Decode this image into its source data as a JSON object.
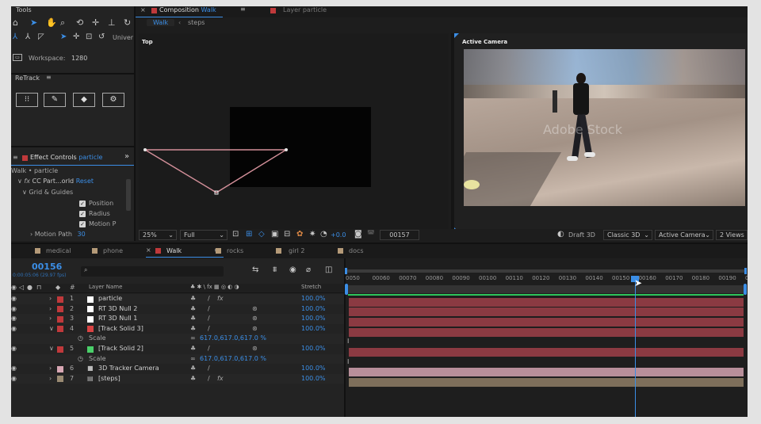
{
  "tools_panel": {
    "title": "Tools",
    "universal_label": "Univer",
    "workspace_label": "Workspace:",
    "workspace_value": "1280"
  },
  "retrack": {
    "title": "ReTrack"
  },
  "effect_controls": {
    "tab_label": "Effect Controls",
    "tab_layer": "particle",
    "breadcrumb": "Walk • particle",
    "effect_name": "CC Part...orld",
    "reset_label": "Reset",
    "group_label": "Grid & Guides",
    "options": [
      "Position",
      "Radius",
      "Motion P"
    ],
    "motion_path_label": "Motion Path",
    "motion_path_value": "30"
  },
  "composition": {
    "tab_prefix": "Composition",
    "tab_name": "Walk",
    "other_tab": "Layer particle",
    "crumbs": [
      "Walk",
      "steps"
    ],
    "left_view_label": "Top",
    "right_view_label": "Active Camera",
    "watermark": "Adobe Stock"
  },
  "viewer_bar": {
    "zoom": "25%",
    "resolution": "Full",
    "exposure": "+0.0",
    "timecode": "00157",
    "renderer": "Draft 3D",
    "renderer_mode": "Classic 3D",
    "camera": "Active Camera",
    "views": "2 Views"
  },
  "timeline_tabs": [
    "medical",
    "phone",
    "Walk",
    "rocks",
    "girl 2",
    "docs"
  ],
  "timeline": {
    "current_frame": "00156",
    "sub_timecode": "0:00:05:06 (29.97 fps)",
    "search_placeholder": "",
    "col_layer_name": "Layer Name",
    "col_stretch": "Stretch",
    "col_hash": "#",
    "ruler": [
      "0050",
      "00060",
      "00070",
      "00080",
      "00090",
      "00100",
      "00110",
      "00120",
      "00130",
      "00140",
      "00150",
      "00160",
      "00170",
      "00180",
      "00190",
      "00"
    ],
    "layers": [
      {
        "num": "1",
        "name": "particle",
        "color": "#c0393b",
        "label_color": "#ffffff",
        "stretch": "100.0%",
        "fx": true,
        "cube": false,
        "bar_color": "#8b3a42"
      },
      {
        "num": "2",
        "name": "RT 3D Null 2",
        "color": "#c0393b",
        "label_color": "#ffffff",
        "stretch": "100.0%",
        "fx": false,
        "cube": true,
        "bar_color": "#8b3a42"
      },
      {
        "num": "3",
        "name": "RT 3D Null 1",
        "color": "#c0393b",
        "label_color": "#ffffff",
        "stretch": "100.0%",
        "fx": false,
        "cube": true,
        "bar_color": "#8b3a42"
      },
      {
        "num": "4",
        "name": "[Track Solid 3]",
        "color": "#c0393b",
        "label_color": "#d94343",
        "stretch": "100.0%",
        "fx": false,
        "cube": true,
        "bar_color": "#8b3a42"
      },
      {
        "num": "5",
        "name": "[Track Solid 2]",
        "color": "#c0393b",
        "label_color": "#4ad06a",
        "stretch": "100.0%",
        "fx": false,
        "cube": true,
        "bar_color": "#8b3a42"
      },
      {
        "num": "6",
        "name": "3D Tracker Camera",
        "color": "#d8a7b4",
        "label_color": "",
        "stretch": "100.0%",
        "fx": false,
        "cube": false,
        "bar_color": "#b88f9a"
      },
      {
        "num": "7",
        "name": "[steps]",
        "color": "#9a8a72",
        "label_color": "",
        "stretch": "100.0%",
        "fx": true,
        "cube": false,
        "bar_color": "#7e6f5b"
      }
    ],
    "scale_label": "Scale",
    "scale_value": "617.0,617.0,617.0 %"
  },
  "colors": {
    "accent": "#3b8ee6",
    "playhead": "#3b8ee6",
    "work_bar": "#2ec45a"
  }
}
